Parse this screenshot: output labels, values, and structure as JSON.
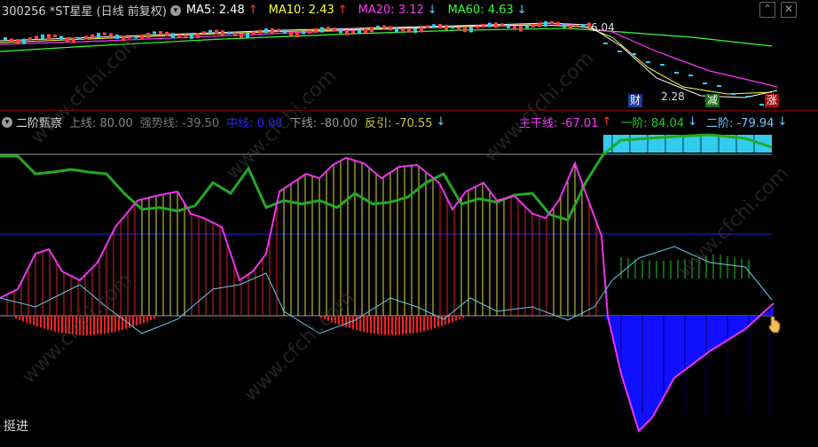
{
  "header": {
    "stock": "300256 *ST星星 (日线 前复权)",
    "ma5_label": "MA5: 2.48",
    "ma5_arrow": "↑",
    "ma10_label": "MA10: 2.43",
    "ma10_arrow": "↑",
    "ma20_label": "MA20: 3.12",
    "ma20_arrow": "↓",
    "ma60_label": "MA60: 4.63",
    "ma60_arrow": "↓",
    "colors": {
      "ma5": "#ffffff",
      "ma10": "#ffff33",
      "ma20": "#ff33ff",
      "ma60": "#33ff33",
      "up_arrow": "#ff3333",
      "down_arrow": "#66ccff"
    }
  },
  "price_panel": {
    "high_label": "6.04",
    "low_label": "2.28",
    "tags": {
      "cai": "财",
      "jian": "减",
      "zhang": "涨"
    }
  },
  "indicator": {
    "name": "二阶甄察",
    "upper_label": "上线: 80.00",
    "strong_label": "强势线: -39.50",
    "mid_label": "中线: 0.00",
    "lower_label": "下线: -80.00",
    "rebound_label": "反引: -70.55",
    "rebound_arrow": "↓",
    "main_label": "主干线: -67.01",
    "main_arrow": "↑",
    "first_label": "一阶: 84.04",
    "first_arrow": "↓",
    "second_label": "二阶: -79.94",
    "second_arrow": "↓"
  },
  "footer": {
    "text": "挺进"
  },
  "watermark": "www.cfchi.com",
  "window": {
    "collapse_icon": "chevron-up-icon",
    "close_icon": "close-icon"
  }
}
